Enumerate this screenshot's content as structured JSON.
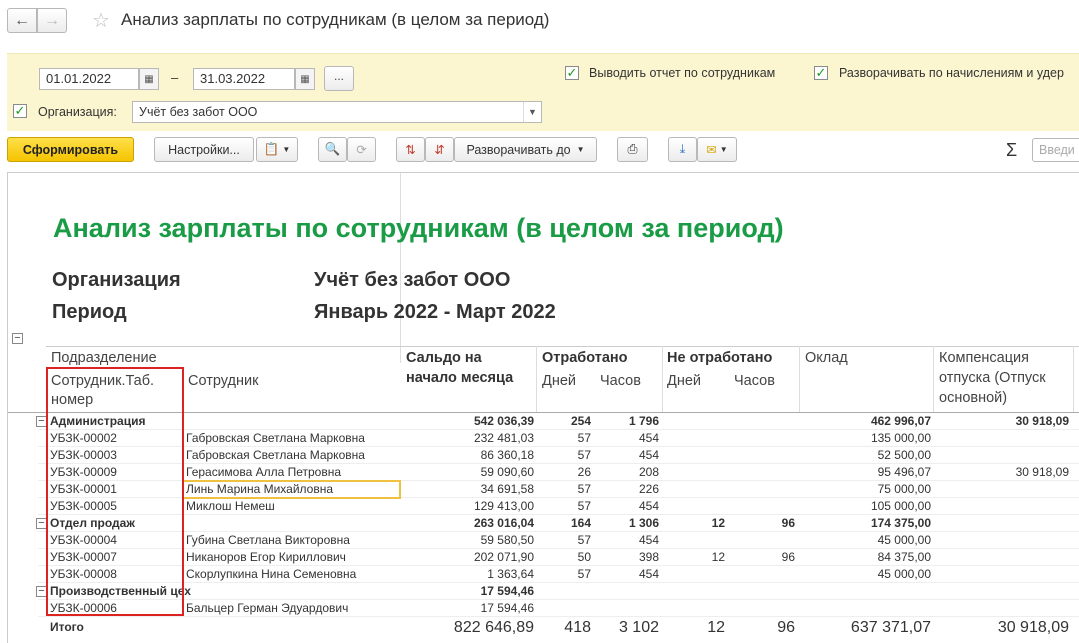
{
  "window": {
    "title": "Анализ зарплаты по сотрудникам (в целом за период)"
  },
  "settings": {
    "date_from": "01.01.2022",
    "date_to": "31.03.2022",
    "dash": "–",
    "dots_label": "...",
    "check_employees_label": "Выводить отчет по сотрудникам",
    "check_expand_label": "Разворачивать по начислениям и удер",
    "org_label": "Организация:",
    "org_value": "Учёт без забот ООО"
  },
  "toolbar": {
    "generate_label": "Сформировать",
    "settings_label": "Настройки...",
    "expand_label": "Разворачивать до",
    "sigma": "Σ",
    "search_placeholder": "Введи"
  },
  "report": {
    "title": "Анализ зарплаты по сотрудникам (в целом за период)",
    "org_label": "Организация",
    "org_value": "Учёт без забот ООО",
    "period_label": "Период",
    "period_value": "Январь 2022 - Март 2022",
    "headers": {
      "department": "Подразделение",
      "tab_number_line1": "Сотрудник.Таб.",
      "tab_number_line2": "номер",
      "employee": "Сотрудник",
      "saldo_line1": "Сальдо на",
      "saldo_line2": "начало месяца",
      "worked": "Отработано",
      "not_worked": "Не отработано",
      "days": "Дней",
      "hours": "Часов",
      "salary": "Оклад",
      "comp_line1": "Компенсация",
      "comp_line2": "отпуска (Отпуск",
      "comp_line3": "основной)"
    },
    "rows": [
      {
        "type": "group",
        "code": "Администрация",
        "name": "",
        "saldo": "542 036,39",
        "w_days": "254",
        "w_hours": "1 796",
        "nw_days": "",
        "nw_hours": "",
        "salary": "462 996,07",
        "comp": "30 918,09"
      },
      {
        "type": "item",
        "code": "УБЗК-00002",
        "name": "Габровская Светлана Марковна",
        "saldo": "232 481,03",
        "w_days": "57",
        "w_hours": "454",
        "nw_days": "",
        "nw_hours": "",
        "salary": "135 000,00",
        "comp": ""
      },
      {
        "type": "item",
        "code": "УБЗК-00003",
        "name": "Габровская Светлана Марковна",
        "saldo": "86 360,18",
        "w_days": "57",
        "w_hours": "454",
        "nw_days": "",
        "nw_hours": "",
        "salary": "52 500,00",
        "comp": ""
      },
      {
        "type": "item",
        "code": "УБЗК-00009",
        "name": "Герасимова Алла Петровна",
        "saldo": "59 090,60",
        "w_days": "26",
        "w_hours": "208",
        "nw_days": "",
        "nw_hours": "",
        "salary": "95 496,07",
        "comp": "30 918,09"
      },
      {
        "type": "item",
        "code": "УБЗК-00001",
        "name": "Линь Марина Михайловна",
        "saldo": "34 691,58",
        "w_days": "57",
        "w_hours": "226",
        "nw_days": "",
        "nw_hours": "",
        "salary": "75 000,00",
        "comp": ""
      },
      {
        "type": "item",
        "code": "УБЗК-00005",
        "name": "Миклош Немеш",
        "saldo": "129 413,00",
        "w_days": "57",
        "w_hours": "454",
        "nw_days": "",
        "nw_hours": "",
        "salary": "105 000,00",
        "comp": ""
      },
      {
        "type": "group",
        "code": "Отдел продаж",
        "name": "",
        "saldo": "263 016,04",
        "w_days": "164",
        "w_hours": "1 306",
        "nw_days": "12",
        "nw_hours": "96",
        "salary": "174 375,00",
        "comp": ""
      },
      {
        "type": "item",
        "code": "УБЗК-00004",
        "name": "Губина Светлана Викторовна",
        "saldo": "59 580,50",
        "w_days": "57",
        "w_hours": "454",
        "nw_days": "",
        "nw_hours": "",
        "salary": "45 000,00",
        "comp": ""
      },
      {
        "type": "item",
        "code": "УБЗК-00007",
        "name": "Никаноров Егор Кириллович",
        "saldo": "202 071,90",
        "w_days": "50",
        "w_hours": "398",
        "nw_days": "12",
        "nw_hours": "96",
        "salary": "84 375,00",
        "comp": ""
      },
      {
        "type": "item",
        "code": "УБЗК-00008",
        "name": "Скорлупкина Нина Семеновна",
        "saldo": "1 363,64",
        "w_days": "57",
        "w_hours": "454",
        "nw_days": "",
        "nw_hours": "",
        "salary": "45 000,00",
        "comp": ""
      },
      {
        "type": "group",
        "code": "Производственный цех",
        "name": "",
        "saldo": "17 594,46",
        "w_days": "",
        "w_hours": "",
        "nw_days": "",
        "nw_hours": "",
        "salary": "",
        "comp": ""
      },
      {
        "type": "item",
        "code": "УБЗК-00006",
        "name": "Бальцер Герман Эдуардович",
        "saldo": "17 594,46",
        "w_days": "",
        "w_hours": "",
        "nw_days": "",
        "nw_hours": "",
        "salary": "",
        "comp": ""
      }
    ],
    "total": {
      "label": "Итого",
      "saldo": "822 646,89",
      "w_days": "418",
      "w_hours": "3 102",
      "nw_days": "12",
      "nw_hours": "96",
      "salary": "637 371,07",
      "comp": "30 918,09"
    }
  }
}
